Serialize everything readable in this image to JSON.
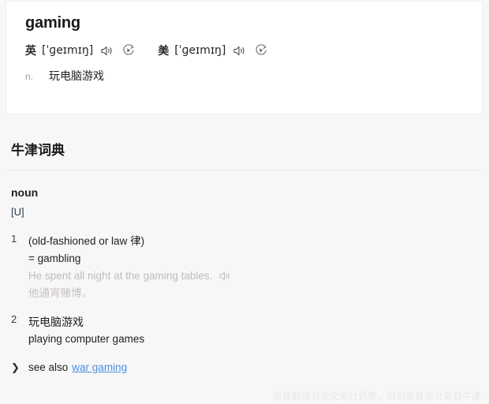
{
  "word_card": {
    "headword": "gaming",
    "pronunciations": [
      {
        "locale_label": "英",
        "ipa": "[ˈɡeɪmɪŋ]",
        "speaker_icon": "speaker-icon",
        "replay_icon": "replay-play-icon"
      },
      {
        "locale_label": "美",
        "ipa": "[ˈɡeɪmɪŋ]",
        "speaker_icon": "speaker-icon",
        "replay_icon": "replay-play-icon"
      }
    ],
    "quick_definition": {
      "pos": "n.",
      "text": "玩电脑游戏"
    }
  },
  "dictionary": {
    "title": "牛津词典",
    "pos_heading": "noun",
    "countability": "[U]",
    "senses": [
      {
        "number": "1",
        "label": "(old-fashioned or law 律)",
        "equivalent": "= gambling",
        "example_en": "He spent all night at the gaming tables.",
        "example_icon": "speaker-icon",
        "example_cn": "他通宵赌博。"
      },
      {
        "number": "2",
        "definition_cn": "玩电脑游戏",
        "definition_en": "playing computer games"
      }
    ],
    "see_also": {
      "chevron_icon": "chevron-right-icon",
      "label": "see also",
      "link_text": "war gaming"
    }
  },
  "footer": {
    "note": "百度翻译对原文进行调整，例句发音部分来自牛津"
  }
}
